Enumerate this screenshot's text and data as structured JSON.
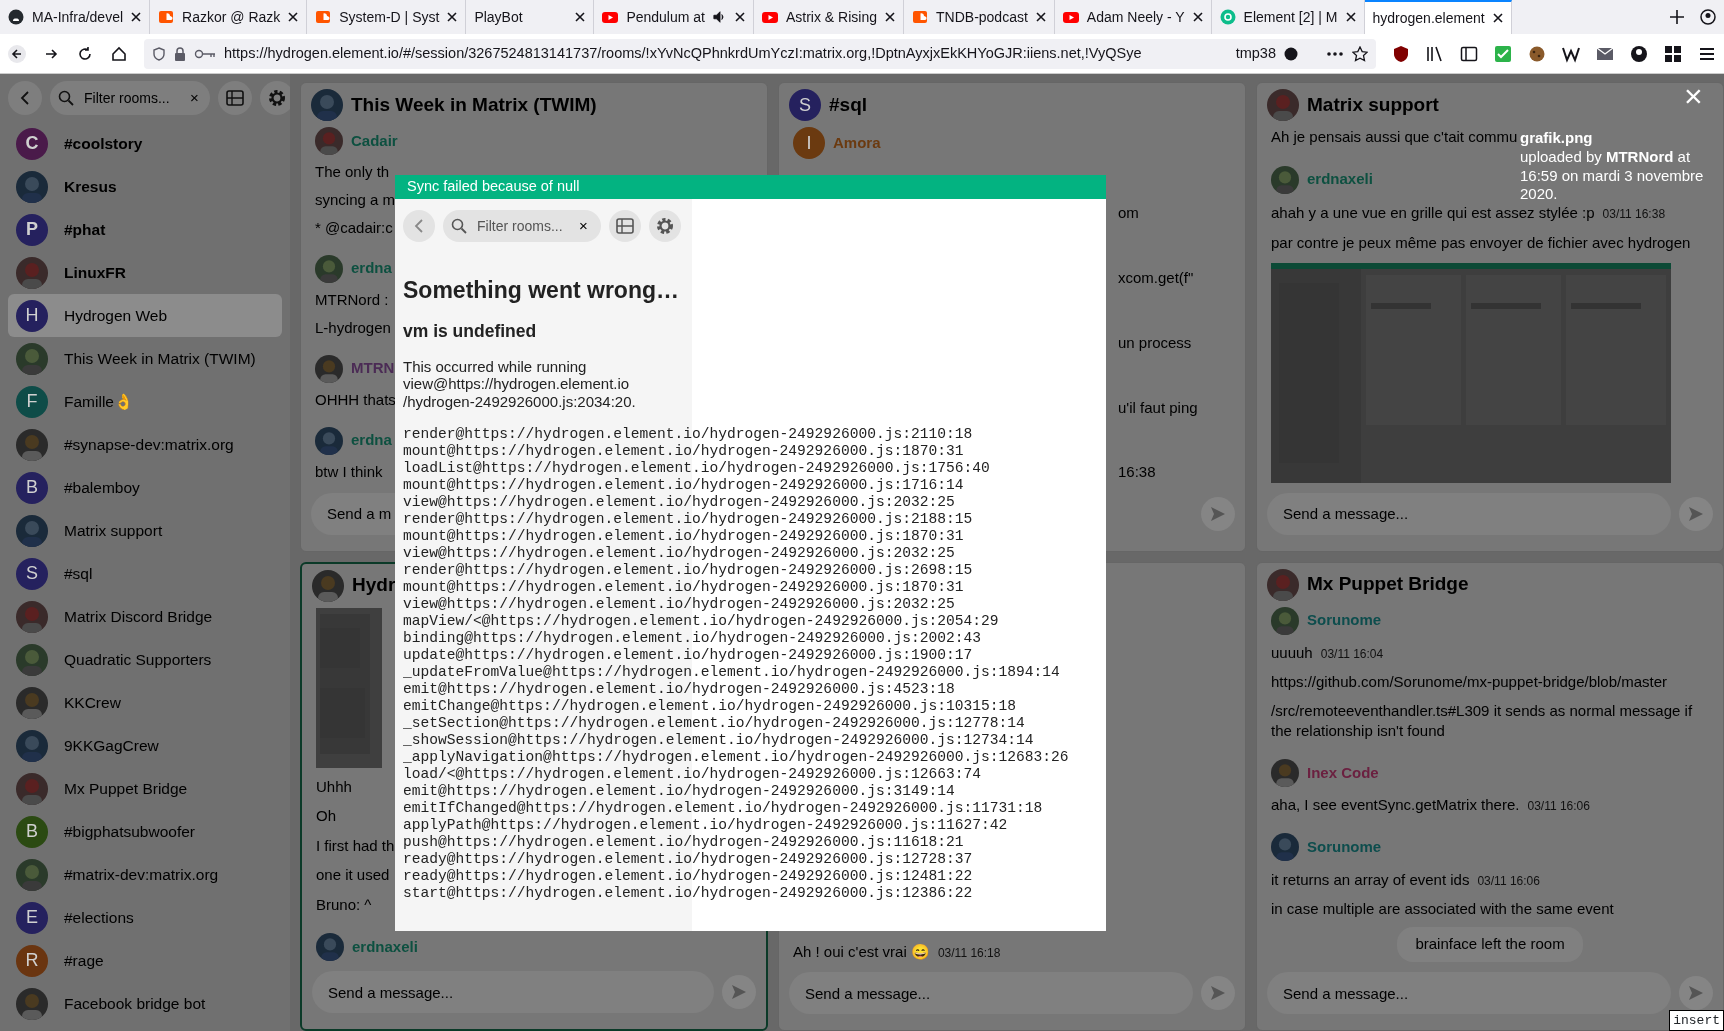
{
  "browser": {
    "tabs": [
      {
        "title": "MA-Infra/devel",
        "kind": "github",
        "audio": false,
        "selected": false
      },
      {
        "title": "Razkor @ Razk",
        "kind": "soundcloud",
        "audio": false,
        "selected": false
      },
      {
        "title": "System-D | Syst",
        "kind": "soundcloud",
        "audio": false,
        "selected": false
      },
      {
        "title": "PlayBot",
        "kind": "plain",
        "audio": false,
        "selected": false
      },
      {
        "title": "Pendulum at",
        "kind": "youtube",
        "audio": true,
        "selected": false
      },
      {
        "title": "Astrix & Rising",
        "kind": "youtube",
        "audio": false,
        "selected": false
      },
      {
        "title": "TNDB-podcast",
        "kind": "soundcloud",
        "audio": false,
        "selected": false
      },
      {
        "title": "Adam Neely - Y",
        "kind": "youtube",
        "audio": false,
        "selected": false
      },
      {
        "title": "Element [2] | M",
        "kind": "element",
        "audio": false,
        "selected": false
      },
      {
        "title": "hydrogen.element",
        "kind": "plain",
        "audio": false,
        "selected": true
      }
    ],
    "url": "https://hydrogen.element.io/#/session/3267524813141737/rooms/!xYvNcQPhnkrdUmYczI:matrix.org,!DptnAyxjxEkKHYoGJR:iiens.net,!VyQSye",
    "container": "tmp38"
  },
  "sidebar": {
    "filter_placeholder": "Filter rooms...",
    "clear": "×",
    "rooms": [
      {
        "name": "#coolstory",
        "avatar": {
          "kind": "letter",
          "letter": "C",
          "color": "#4a1a4a"
        },
        "unread": true,
        "selected": false
      },
      {
        "name": "Kresus",
        "avatar": {
          "kind": "picture"
        },
        "unread": true,
        "selected": false
      },
      {
        "name": "#phat",
        "avatar": {
          "kind": "letter",
          "letter": "P",
          "color": "#25215e"
        },
        "unread": true,
        "selected": false
      },
      {
        "name": "LinuxFR",
        "avatar": {
          "kind": "picture"
        },
        "unread": true,
        "selected": false
      },
      {
        "name": "Hydrogen Web",
        "avatar": {
          "kind": "letter",
          "letter": "H",
          "color": "#25215e"
        },
        "unread": false,
        "selected": true
      },
      {
        "name": "This Week in Matrix (TWIM)",
        "avatar": {
          "kind": "picture"
        },
        "unread": false,
        "selected": false
      },
      {
        "name": "Famille👌",
        "avatar": {
          "kind": "letter",
          "letter": "F",
          "color": "#0e4c48"
        },
        "unread": false,
        "selected": false
      },
      {
        "name": "#synapse-dev:matrix.org",
        "avatar": {
          "kind": "picture"
        },
        "unread": false,
        "selected": false
      },
      {
        "name": "#balemboy",
        "avatar": {
          "kind": "letter",
          "letter": "B",
          "color": "#25215e"
        },
        "unread": false,
        "selected": false
      },
      {
        "name": "Matrix support",
        "avatar": {
          "kind": "picture"
        },
        "unread": false,
        "selected": false
      },
      {
        "name": "#sql",
        "avatar": {
          "kind": "letter",
          "letter": "S",
          "color": "#25215e"
        },
        "unread": false,
        "selected": false
      },
      {
        "name": "Matrix Discord Bridge",
        "avatar": {
          "kind": "picture"
        },
        "unread": false,
        "selected": false
      },
      {
        "name": "Quadratic Supporters",
        "avatar": {
          "kind": "picture"
        },
        "unread": false,
        "selected": false
      },
      {
        "name": "KKCrew",
        "avatar": {
          "kind": "picture"
        },
        "unread": false,
        "selected": false
      },
      {
        "name": "9KKGagCrew",
        "avatar": {
          "kind": "picture"
        },
        "unread": false,
        "selected": false
      },
      {
        "name": "Mx Puppet Bridge",
        "avatar": {
          "kind": "picture"
        },
        "unread": false,
        "selected": false
      },
      {
        "name": "#bigphatsubwoofer",
        "avatar": {
          "kind": "letter",
          "letter": "B",
          "color": "#2b4a12"
        },
        "unread": false,
        "selected": false
      },
      {
        "name": "#matrix-dev:matrix.org",
        "avatar": {
          "kind": "picture"
        },
        "unread": false,
        "selected": false
      },
      {
        "name": "#elections",
        "avatar": {
          "kind": "letter",
          "letter": "E",
          "color": "#25215e"
        },
        "unread": false,
        "selected": false
      },
      {
        "name": "#rage",
        "avatar": {
          "kind": "letter",
          "letter": "R",
          "color": "#6a3510"
        },
        "unread": false,
        "selected": false
      },
      {
        "name": "Facebook bridge bot",
        "avatar": {
          "kind": "picture"
        },
        "unread": false,
        "selected": false
      }
    ]
  },
  "tiles": [
    {
      "title": "This Week in Matrix (TWIM)",
      "avatar": {
        "kind": "picture"
      },
      "focused": false,
      "messages": [
        {
          "kind": "sender",
          "name": "Cadair",
          "color": "#0d5040"
        },
        {
          "kind": "text",
          "text": "The only th"
        },
        {
          "kind": "text",
          "text": "syncing a m"
        },
        {
          "kind": "text",
          "text": "* @cadair:c"
        },
        {
          "kind": "sender",
          "name": "erdna",
          "color": "#0d5040"
        },
        {
          "kind": "text",
          "text": "MTRNord :"
        },
        {
          "kind": "text",
          "text": "L-hydrogen"
        },
        {
          "kind": "sender",
          "name": "MTRN",
          "color": "#4b2b55"
        },
        {
          "kind": "text",
          "text": "OHHH thats"
        },
        {
          "kind": "sender",
          "name": "erdna",
          "color": "#0d5040"
        },
        {
          "kind": "text",
          "text": "btw I think"
        }
      ],
      "composer": {
        "placeholder": "Send a m",
        "send": false
      }
    },
    {
      "title": "#sql",
      "avatar": {
        "kind": "letter",
        "letter": "S",
        "color": "#25215e"
      },
      "focused": false,
      "messages": [
        {
          "kind": "sender",
          "name": "Amora",
          "color": "#6b3a10",
          "letter": "I"
        },
        {
          "kind": "fragment",
          "text": "om"
        },
        {
          "kind": "fragment",
          "text": "xcom.get(f\""
        },
        {
          "kind": "fragment",
          "text": "un process"
        },
        {
          "kind": "fragment",
          "text": "u'il faut ping"
        },
        {
          "kind": "fragment",
          "text": "16:38"
        }
      ],
      "composer": {
        "send": true
      }
    },
    {
      "title": "Matrix support",
      "avatar": {
        "kind": "picture"
      },
      "focused": false,
      "messages": [
        {
          "kind": "text",
          "text": "Ah je pensais aussi que c'tait commu"
        },
        {
          "kind": "sender",
          "name": "erdnaxeli",
          "color": "#0d5040"
        },
        {
          "kind": "text",
          "text": "ahah y a une vue en grille qui est assez stylée :p",
          "time": "03/11 16:38"
        },
        {
          "kind": "text",
          "text": "par contre je peux même pas envoyer de fichier avec hydrogen"
        },
        {
          "kind": "picture"
        }
      ],
      "composer": {
        "placeholder": "Send a message...",
        "send": true
      }
    },
    {
      "title": "Hydr",
      "avatar": {
        "kind": "picture"
      },
      "focused": true,
      "messages": [
        {
          "kind": "picture"
        },
        {
          "kind": "text",
          "text": "Uhhh"
        },
        {
          "kind": "text",
          "text": "Oh"
        },
        {
          "kind": "text",
          "text": "I first had th"
        },
        {
          "kind": "text",
          "text": "one it used"
        },
        {
          "kind": "text",
          "text": "Bruno: ^"
        },
        {
          "kind": "sender",
          "name": "erdnaxeli",
          "color": "#0d5040"
        }
      ],
      "composer": {
        "placeholder": "Send a message...",
        "send": true
      }
    },
    {
      "avatar": {
        "kind": "none"
      },
      "focused": false,
      "messages": [
        {
          "kind": "text",
          "text": "Ah ! oui c'est vrai 😄",
          "time": "03/11 16:18"
        }
      ],
      "composer": {
        "placeholder": "Send a message...",
        "send": true
      }
    },
    {
      "title": "Mx Puppet Bridge",
      "avatar": {
        "kind": "picture"
      },
      "focused": false,
      "messages": [
        {
          "kind": "sender",
          "name": "Sorunome",
          "color": "#0d4d4d"
        },
        {
          "kind": "text",
          "text": "uuuuh",
          "time": "03/11 16:04"
        },
        {
          "kind": "text",
          "text": "https://github.com/Sorunome/mx-puppet-bridge/blob/master"
        },
        {
          "kind": "text",
          "text": "/src/remoteeventhandler.ts#L309 it sends as normal message if the relationship isn't found"
        },
        {
          "kind": "sender",
          "name": "Inex Code",
          "color": "#6b2040"
        },
        {
          "kind": "text",
          "text": "aha, I see eventSync.getMatrix there.",
          "time": "03/11 16:06"
        },
        {
          "kind": "sender",
          "name": "Sorunome",
          "color": "#0d4d4d"
        },
        {
          "kind": "text",
          "text": "it returns an array of event ids",
          "time": "03/11 16:06"
        },
        {
          "kind": "text",
          "text": "in case multiple are associated with the same event"
        },
        {
          "kind": "notice",
          "text": "brainface left the room"
        }
      ],
      "composer": {
        "placeholder": "Send a message...",
        "send": true
      }
    }
  ],
  "lightbox": {
    "close": "×",
    "filename": "grafik.png",
    "caption": "uploaded by **MTRNord** at 16:59 on mardi 3 novembre 2020."
  },
  "dialog": {
    "banner": "Sync failed because of null",
    "filter_placeholder": "Filter rooms...",
    "clear": "×",
    "title": "Something went wrong…",
    "error": "vm is undefined",
    "detail": "This occurred while running view@https://hydrogen.element.io /hydrogen-2492926000.js:2034:20.",
    "stack": [
      "render@https://hydrogen.element.io/hydrogen-2492926000.js:2110:18",
      "mount@https://hydrogen.element.io/hydrogen-2492926000.js:1870:31",
      "loadList@https://hydrogen.element.io/hydrogen-2492926000.js:1756:40",
      "mount@https://hydrogen.element.io/hydrogen-2492926000.js:1716:14",
      "view@https://hydrogen.element.io/hydrogen-2492926000.js:2032:25",
      "render@https://hydrogen.element.io/hydrogen-2492926000.js:2188:15",
      "mount@https://hydrogen.element.io/hydrogen-2492926000.js:1870:31",
      "view@https://hydrogen.element.io/hydrogen-2492926000.js:2032:25",
      "render@https://hydrogen.element.io/hydrogen-2492926000.js:2698:15",
      "mount@https://hydrogen.element.io/hydrogen-2492926000.js:1870:31",
      "view@https://hydrogen.element.io/hydrogen-2492926000.js:2032:25",
      "mapView/<@https://hydrogen.element.io/hydrogen-2492926000.js:2054:29",
      "binding@https://hydrogen.element.io/hydrogen-2492926000.js:2002:43",
      "update@https://hydrogen.element.io/hydrogen-2492926000.js:1900:17",
      "_updateFromValue@https://hydrogen.element.io/hydrogen-2492926000.js:1894:14",
      "emit@https://hydrogen.element.io/hydrogen-2492926000.js:4523:18",
      "emitChange@https://hydrogen.element.io/hydrogen-2492926000.js:10315:18",
      "_setSection@https://hydrogen.element.io/hydrogen-2492926000.js:12778:14",
      "_showSession@https://hydrogen.element.io/hydrogen-2492926000.js:12734:14",
      "_applyNavigation@https://hydrogen.element.io/hydrogen-2492926000.js:12683:26",
      "load/<@https://hydrogen.element.io/hydrogen-2492926000.js:12663:74",
      "emit@https://hydrogen.element.io/hydrogen-2492926000.js:3149:14",
      "emitIfChanged@https://hydrogen.element.io/hydrogen-2492926000.js:11731:18",
      "applyPath@https://hydrogen.element.io/hydrogen-2492926000.js:11627:42",
      "push@https://hydrogen.element.io/hydrogen-2492926000.js:11618:21",
      "ready@https://hydrogen.element.io/hydrogen-2492926000.js:12728:37",
      "ready@https://hydrogen.element.io/hydrogen-2492926000.js:12481:22",
      "start@https://hydrogen.element.io/hydrogen-2492926000.js:12386:22"
    ]
  },
  "mode_badge": "insert"
}
